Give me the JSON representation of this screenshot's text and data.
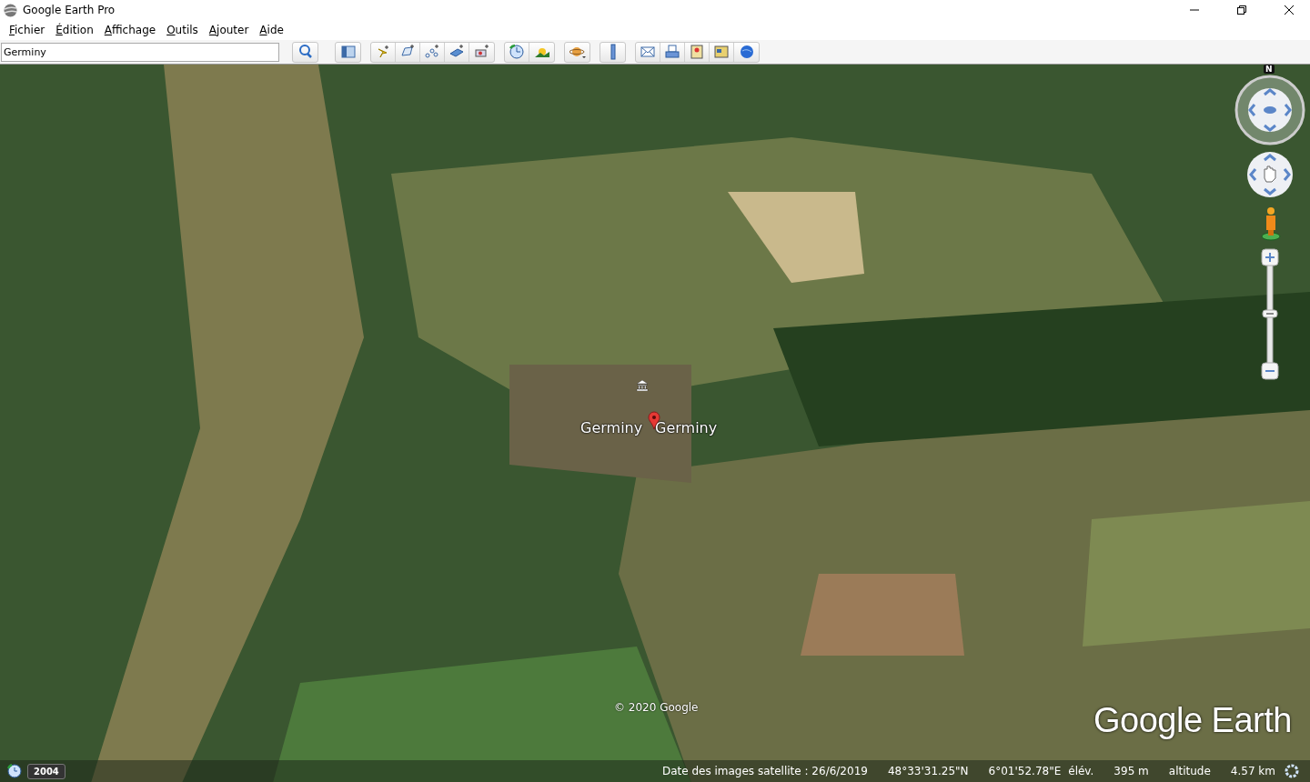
{
  "window": {
    "title": "Google Earth Pro"
  },
  "menu": [
    "Fichier",
    "Édition",
    "Affichage",
    "Outils",
    "Ajouter",
    "Aide"
  ],
  "search": {
    "value": "Germiny"
  },
  "map": {
    "place_labels": [
      "Germiny",
      "Germiny"
    ],
    "copyright": "© 2020 Google",
    "logo": "Google Earth",
    "compass_north": "N"
  },
  "status_bar": {
    "historical_year": "2004",
    "imagery_date": "Date des images satellite : 26/6/2019",
    "latitude": "48°33'31.25\"N",
    "longitude": "6°01'52.78\"E",
    "elevation_label": "élév.",
    "elevation": "395 m",
    "altitude_label": "altitude",
    "altitude": "4.57 km"
  }
}
